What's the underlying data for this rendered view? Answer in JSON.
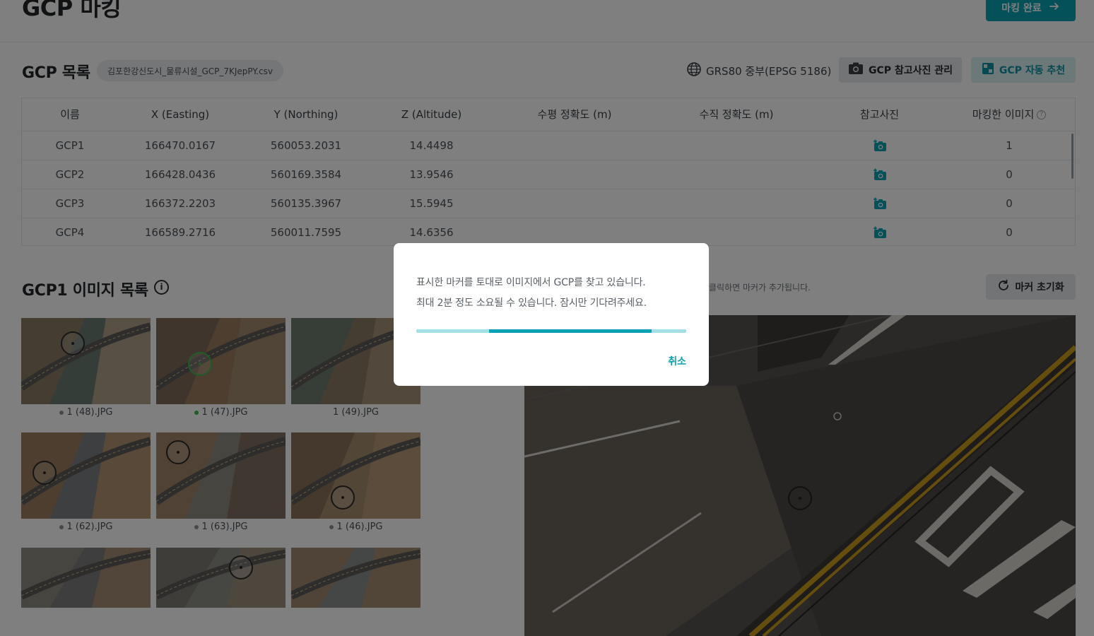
{
  "header": {
    "title": "GCP 마킹",
    "complete_button": "마킹 완료",
    "complete_icon": "arrow-right-icon"
  },
  "gcp_list": {
    "title": "GCP 목록",
    "file_name": "김포한강신도시_물류시설_GCP_7KJepPY.csv",
    "crs": "GRS80 중부(EPSG 5186)",
    "ref_photo_button": "GCP 참고사진 관리",
    "auto_recommend_button": "GCP 자동 추천",
    "columns": [
      "이름",
      "X (Easting)",
      "Y (Northing)",
      "Z (Altitude)",
      "수평 정확도 (m)",
      "수직 정확도 (m)",
      "참고사진",
      "마킹한 이미지"
    ],
    "help_mark": "?",
    "rows": [
      {
        "name": "GCP1",
        "x": "166470.0167",
        "y": "560053.2031",
        "z": "14.4498",
        "h_acc": "",
        "v_acc": "",
        "marked": "1"
      },
      {
        "name": "GCP2",
        "x": "166428.0436",
        "y": "560169.3584",
        "z": "13.9546",
        "h_acc": "",
        "v_acc": "",
        "marked": "0"
      },
      {
        "name": "GCP3",
        "x": "166372.2203",
        "y": "560135.3967",
        "z": "15.5945",
        "h_acc": "",
        "v_acc": "",
        "marked": "0"
      },
      {
        "name": "GCP4",
        "x": "166589.2716",
        "y": "560011.7595",
        "z": "14.6356",
        "h_acc": "",
        "v_acc": "",
        "marked": "0"
      }
    ],
    "accent_color": "#08a2b4"
  },
  "image_list": {
    "title": "GCP1 이미지 목록",
    "info_mark": "i",
    "hint": "클릭하면 마커가 추가됩니다.",
    "reset_button": "마커 초기화",
    "images": [
      {
        "label": "1 (48).JPG",
        "status": "gray",
        "selected": true
      },
      {
        "label": "1 (47).JPG",
        "status": "green",
        "selected": false
      },
      {
        "label": "1 (49).JPG",
        "status": "none",
        "selected": false
      },
      {
        "label": "1 (62).JPG",
        "status": "gray",
        "selected": false
      },
      {
        "label": "1 (63).JPG",
        "status": "gray",
        "selected": false
      },
      {
        "label": "1 (46).JPG",
        "status": "gray",
        "selected": false
      },
      {
        "label": "",
        "status": "none",
        "selected": false
      },
      {
        "label": "",
        "status": "none",
        "selected": false
      },
      {
        "label": "",
        "status": "none",
        "selected": false
      }
    ]
  },
  "modal": {
    "line1": "표시한 마커를 토대로 이미지에서 GCP를 찾고 있습니다.",
    "line2": "최대 2분 정도 소요될 수 있습니다. 잠시만 기다려주세요.",
    "cancel": "취소"
  }
}
